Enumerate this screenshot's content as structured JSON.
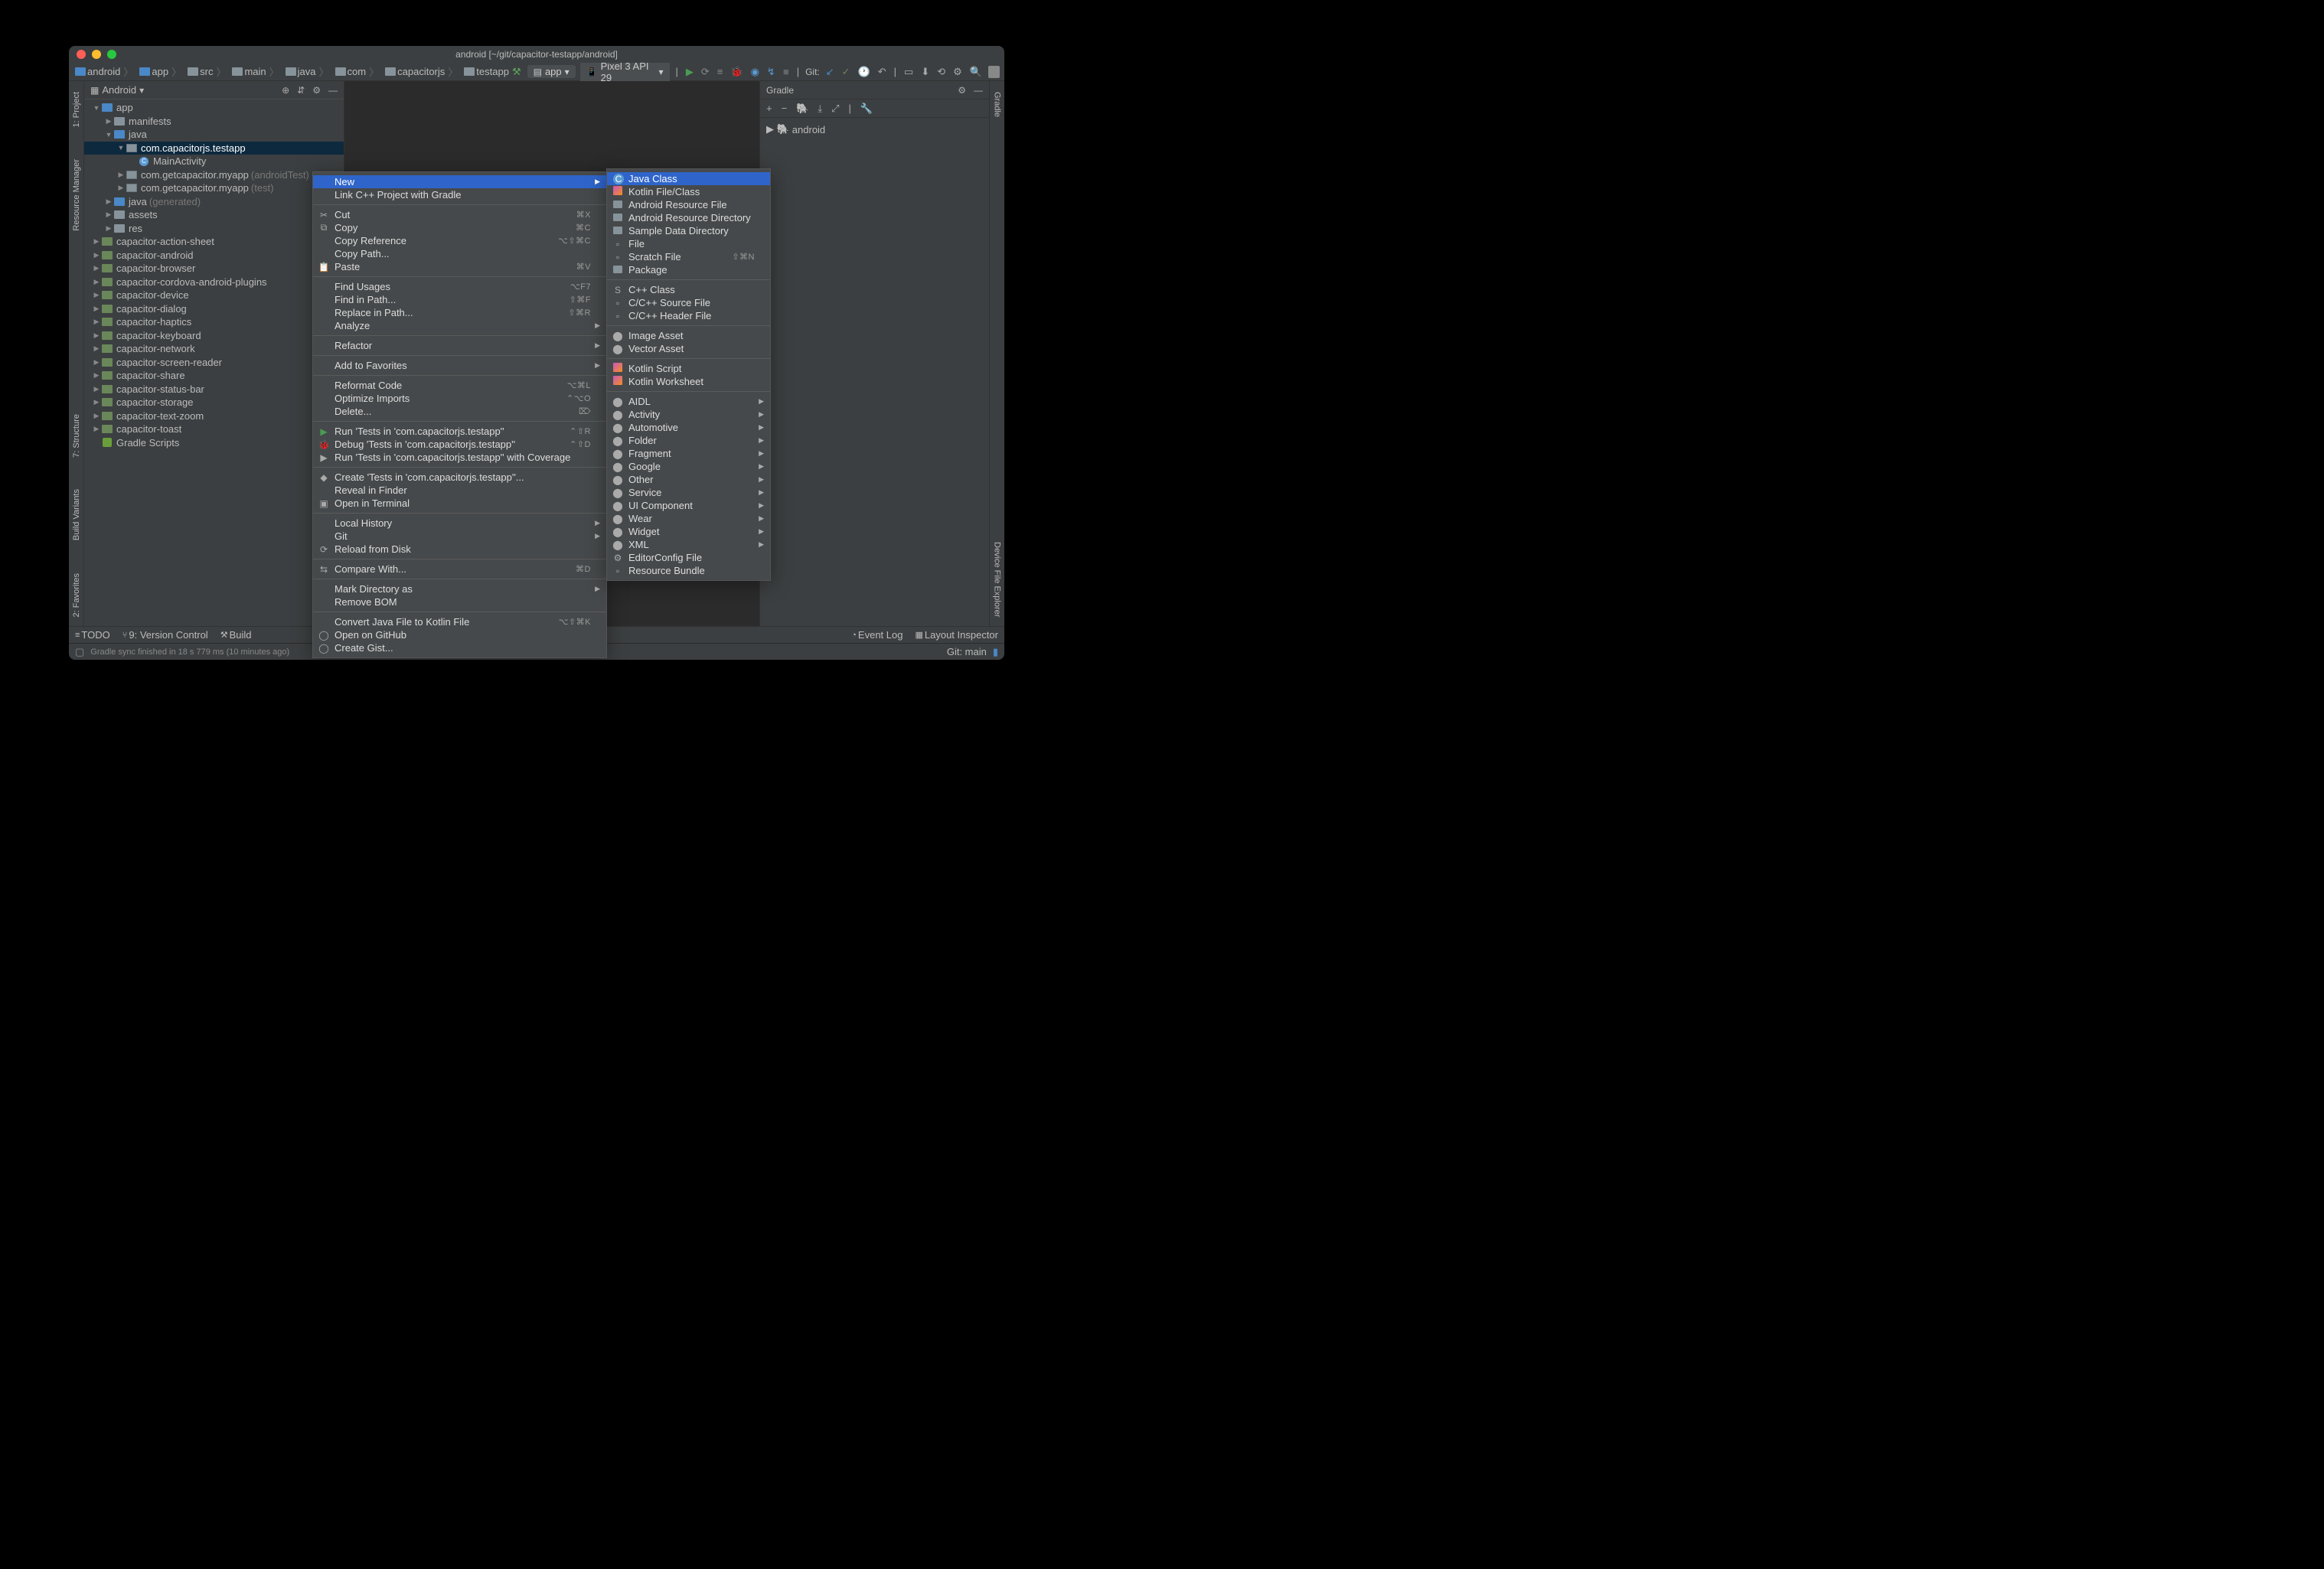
{
  "title": "android [~/git/capacitor-testapp/android]",
  "breadcrumbs": [
    "android",
    "app",
    "src",
    "main",
    "java",
    "com",
    "capacitorjs",
    "testapp"
  ],
  "runConfig": {
    "app": "app",
    "device": "Pixel 3 API 29"
  },
  "git_label": "Git:",
  "android_label": "Android",
  "rails": {
    "project": "1: Project",
    "resource": "Resource Manager",
    "structure": "7: Structure",
    "variants": "Build Variants",
    "favorites": "2: Favorites",
    "gradle": "Gradle",
    "dfe": "Device File Explorer"
  },
  "tree": [
    {
      "d": 0,
      "s": "open",
      "i": "folder blue",
      "t": "app"
    },
    {
      "d": 1,
      "s": "closed",
      "i": "folder",
      "t": "manifests"
    },
    {
      "d": 1,
      "s": "open",
      "i": "folder blue",
      "t": "java"
    },
    {
      "d": 2,
      "s": "open",
      "i": "folder pkg",
      "t": "com.capacitorjs.testapp",
      "sel": true
    },
    {
      "d": 3,
      "s": "none",
      "i": "file-c",
      "t": "MainActivity"
    },
    {
      "d": 2,
      "s": "closed",
      "i": "folder pkg",
      "t": "com.getcapacitor.myapp",
      "dim": "(androidTest)"
    },
    {
      "d": 2,
      "s": "closed",
      "i": "folder pkg",
      "t": "com.getcapacitor.myapp",
      "dim": "(test)"
    },
    {
      "d": 1,
      "s": "closed",
      "i": "folder blue",
      "t": "java",
      "dim": "(generated)"
    },
    {
      "d": 1,
      "s": "closed",
      "i": "folder",
      "t": "assets"
    },
    {
      "d": 1,
      "s": "closed",
      "i": "folder",
      "t": "res"
    },
    {
      "d": 0,
      "s": "closed",
      "i": "lib",
      "t": "capacitor-action-sheet"
    },
    {
      "d": 0,
      "s": "closed",
      "i": "lib",
      "t": "capacitor-android"
    },
    {
      "d": 0,
      "s": "closed",
      "i": "lib",
      "t": "capacitor-browser"
    },
    {
      "d": 0,
      "s": "closed",
      "i": "lib",
      "t": "capacitor-cordova-android-plugins"
    },
    {
      "d": 0,
      "s": "closed",
      "i": "lib",
      "t": "capacitor-device"
    },
    {
      "d": 0,
      "s": "closed",
      "i": "lib",
      "t": "capacitor-dialog"
    },
    {
      "d": 0,
      "s": "closed",
      "i": "lib",
      "t": "capacitor-haptics"
    },
    {
      "d": 0,
      "s": "closed",
      "i": "lib",
      "t": "capacitor-keyboard"
    },
    {
      "d": 0,
      "s": "closed",
      "i": "lib",
      "t": "capacitor-network"
    },
    {
      "d": 0,
      "s": "closed",
      "i": "lib",
      "t": "capacitor-screen-reader"
    },
    {
      "d": 0,
      "s": "closed",
      "i": "lib",
      "t": "capacitor-share"
    },
    {
      "d": 0,
      "s": "closed",
      "i": "lib",
      "t": "capacitor-status-bar"
    },
    {
      "d": 0,
      "s": "closed",
      "i": "lib",
      "t": "capacitor-storage"
    },
    {
      "d": 0,
      "s": "closed",
      "i": "lib",
      "t": "capacitor-text-zoom"
    },
    {
      "d": 0,
      "s": "closed",
      "i": "lib",
      "t": "capacitor-toast"
    },
    {
      "d": 0,
      "s": "none",
      "i": "grad",
      "t": "Gradle Scripts"
    }
  ],
  "gradle_panel": {
    "title": "Gradle",
    "root": "android"
  },
  "bottom": {
    "todo": "TODO",
    "vc": "9: Version Control",
    "build": "Build",
    "eventlog": "Event Log",
    "layout": "Layout Inspector"
  },
  "status": {
    "msg": "Gradle sync finished in 18 s 779 ms (10 minutes ago)",
    "branch": "Git: main"
  },
  "ctx_main": [
    {
      "t": "New",
      "hl": true,
      "sub": true
    },
    {
      "t": "Link C++ Project with Gradle"
    },
    {
      "sep": true
    },
    {
      "t": "Cut",
      "k": "⌘X",
      "i": "✂"
    },
    {
      "t": "Copy",
      "k": "⌘C",
      "i": "⧉"
    },
    {
      "t": "Copy Reference",
      "k": "⌥⇧⌘C"
    },
    {
      "t": "Copy Path..."
    },
    {
      "t": "Paste",
      "k": "⌘V",
      "i": "📋"
    },
    {
      "sep": true
    },
    {
      "t": "Find Usages",
      "k": "⌥F7"
    },
    {
      "t": "Find in Path...",
      "k": "⇧⌘F"
    },
    {
      "t": "Replace in Path...",
      "k": "⇧⌘R"
    },
    {
      "t": "Analyze",
      "sub": true
    },
    {
      "sep": true
    },
    {
      "t": "Refactor",
      "sub": true
    },
    {
      "sep": true
    },
    {
      "t": "Add to Favorites",
      "sub": true
    },
    {
      "sep": true
    },
    {
      "t": "Reformat Code",
      "k": "⌥⌘L"
    },
    {
      "t": "Optimize Imports",
      "k": "⌃⌥O"
    },
    {
      "t": "Delete...",
      "k": "⌦"
    },
    {
      "sep": true
    },
    {
      "t": "Run 'Tests in 'com.capacitorjs.testapp''",
      "k": "⌃⇧R",
      "i": "▶",
      "ic": "play"
    },
    {
      "t": "Debug 'Tests in 'com.capacitorjs.testapp''",
      "k": "⌃⇧D",
      "i": "🐞",
      "ic": "bug"
    },
    {
      "t": "Run 'Tests in 'com.capacitorjs.testapp'' with Coverage",
      "i": "▶"
    },
    {
      "sep": true
    },
    {
      "t": "Create 'Tests in 'com.capacitorjs.testapp''...",
      "i": "◆"
    },
    {
      "t": "Reveal in Finder"
    },
    {
      "t": "Open in Terminal",
      "i": "▣"
    },
    {
      "sep": true
    },
    {
      "t": "Local History",
      "sub": true
    },
    {
      "t": "Git",
      "sub": true
    },
    {
      "t": "Reload from Disk",
      "i": "⟳"
    },
    {
      "sep": true
    },
    {
      "t": "Compare With...",
      "k": "⌘D",
      "i": "⇆"
    },
    {
      "sep": true
    },
    {
      "t": "Mark Directory as",
      "sub": true
    },
    {
      "t": "Remove BOM"
    },
    {
      "sep": true
    },
    {
      "t": "Convert Java File to Kotlin File",
      "k": "⌥⇧⌘K"
    },
    {
      "t": "Open on GitHub",
      "i": "◯"
    },
    {
      "t": "Create Gist...",
      "i": "◯"
    }
  ],
  "ctx_sub": [
    {
      "t": "Java Class",
      "hl": true,
      "i": "C",
      "ic": "java"
    },
    {
      "t": "Kotlin File/Class",
      "i": "kt"
    },
    {
      "t": "Android Resource File",
      "i": "dir"
    },
    {
      "t": "Android Resource Directory",
      "i": "dir"
    },
    {
      "t": "Sample Data Directory",
      "i": "dir"
    },
    {
      "t": "File",
      "i": "▫"
    },
    {
      "t": "Scratch File",
      "k": "⇧⌘N",
      "i": "▫"
    },
    {
      "t": "Package",
      "i": "dir"
    },
    {
      "sep": true
    },
    {
      "t": "C++ Class",
      "i": "S"
    },
    {
      "t": "C/C++ Source File",
      "i": "▫"
    },
    {
      "t": "C/C++ Header File",
      "i": "▫"
    },
    {
      "sep": true
    },
    {
      "t": "Image Asset",
      "i": "andr"
    },
    {
      "t": "Vector Asset",
      "i": "andr"
    },
    {
      "sep": true
    },
    {
      "t": "Kotlin Script",
      "i": "kt"
    },
    {
      "t": "Kotlin Worksheet",
      "i": "kt"
    },
    {
      "sep": true
    },
    {
      "t": "AIDL",
      "i": "andr",
      "sub": true
    },
    {
      "t": "Activity",
      "i": "andr",
      "sub": true
    },
    {
      "t": "Automotive",
      "i": "andr",
      "sub": true
    },
    {
      "t": "Folder",
      "i": "andr",
      "sub": true
    },
    {
      "t": "Fragment",
      "i": "andr",
      "sub": true
    },
    {
      "t": "Google",
      "i": "andr",
      "sub": true
    },
    {
      "t": "Other",
      "i": "andr",
      "sub": true
    },
    {
      "t": "Service",
      "i": "andr",
      "sub": true
    },
    {
      "t": "UI Component",
      "i": "andr",
      "sub": true
    },
    {
      "t": "Wear",
      "i": "andr",
      "sub": true
    },
    {
      "t": "Widget",
      "i": "andr",
      "sub": true
    },
    {
      "t": "XML",
      "i": "andr",
      "sub": true
    },
    {
      "t": "EditorConfig File",
      "i": "⚙"
    },
    {
      "t": "Resource Bundle",
      "i": "▫"
    }
  ]
}
